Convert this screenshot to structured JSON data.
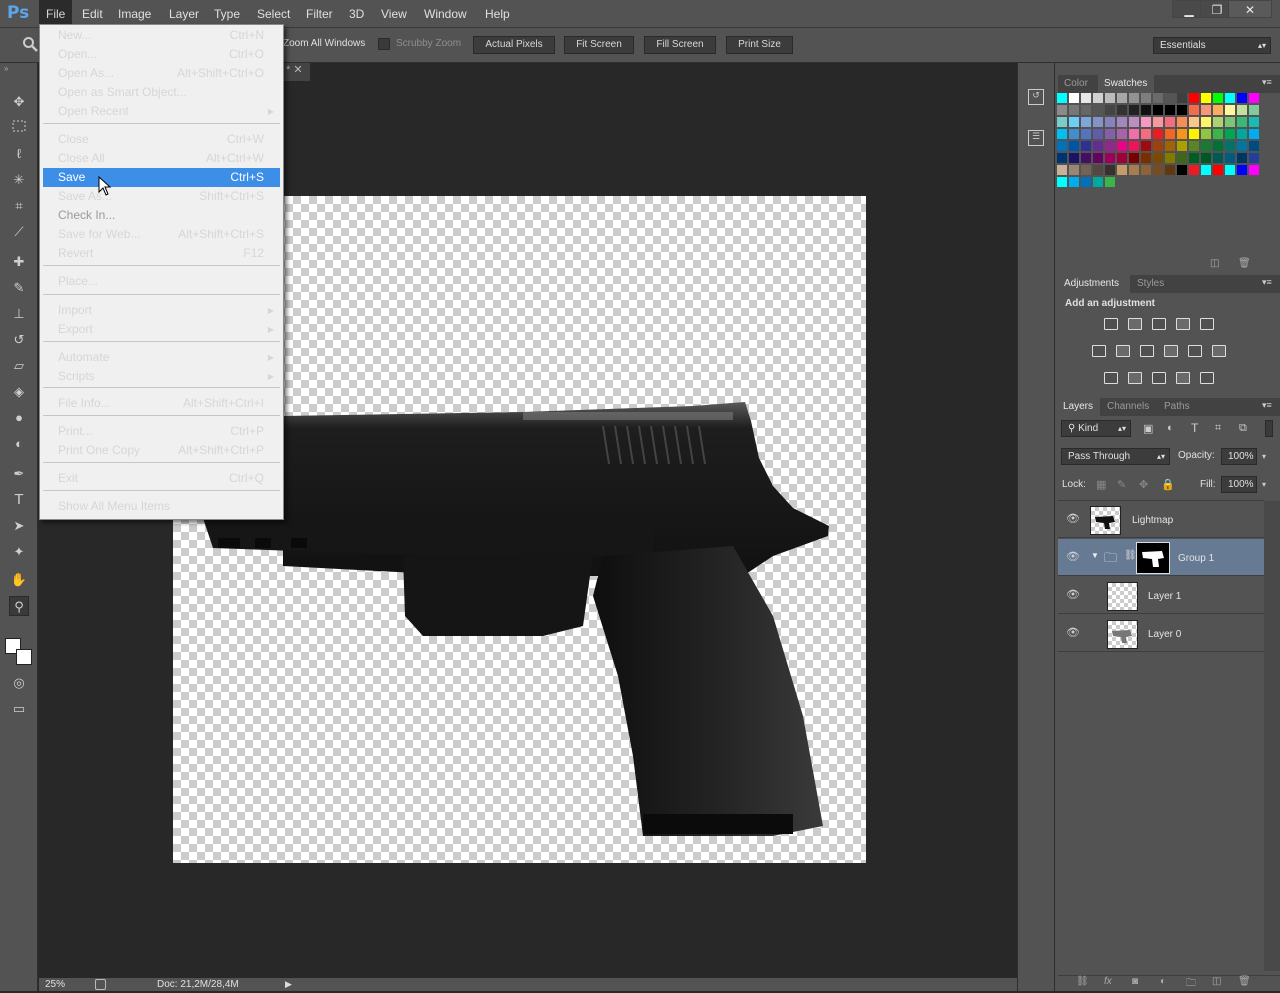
{
  "app": {
    "logo": "Ps"
  },
  "menubar": {
    "items": [
      "File",
      "Edit",
      "Image",
      "Layer",
      "Type",
      "Select",
      "Filter",
      "3D",
      "View",
      "Window",
      "Help"
    ],
    "window_controls": [
      "▁",
      "❐",
      "✕"
    ]
  },
  "options_bar": {
    "zoom_all_windows": "Zoom All Windows",
    "scrubby_zoom": "Scrubby Zoom",
    "buttons": [
      "Actual Pixels",
      "Fit Screen",
      "Fill Screen",
      "Print Size"
    ],
    "workspace": "Essentials"
  },
  "file_menu": {
    "items": [
      {
        "label": "New...",
        "shortcut": "Ctrl+N"
      },
      {
        "label": "Open...",
        "shortcut": "Ctrl+O"
      },
      {
        "label": "Open As...",
        "shortcut": "Alt+Shift+Ctrl+O"
      },
      {
        "label": "Open as Smart Object...",
        "shortcut": ""
      },
      {
        "label": "Open Recent",
        "shortcut": "",
        "submenu": true
      },
      {
        "label": "Close",
        "shortcut": "Ctrl+W"
      },
      {
        "label": "Close All",
        "shortcut": "Alt+Ctrl+W"
      },
      {
        "label": "Save",
        "shortcut": "Ctrl+S",
        "highlighted": true
      },
      {
        "label": "Save As...",
        "shortcut": "Shift+Ctrl+S"
      },
      {
        "label": "Check In...",
        "shortcut": "",
        "disabled": true
      },
      {
        "label": "Save for Web...",
        "shortcut": "Alt+Shift+Ctrl+S"
      },
      {
        "label": "Revert",
        "shortcut": "F12"
      },
      {
        "label": "Place...",
        "shortcut": ""
      },
      {
        "label": "Import",
        "shortcut": "",
        "submenu": true
      },
      {
        "label": "Export",
        "shortcut": "",
        "submenu": true
      },
      {
        "label": "Automate",
        "shortcut": "",
        "submenu": true
      },
      {
        "label": "Scripts",
        "shortcut": "",
        "submenu": true
      },
      {
        "label": "File Info...",
        "shortcut": "Alt+Shift+Ctrl+I"
      },
      {
        "label": "Print...",
        "shortcut": "Ctrl+P"
      },
      {
        "label": "Print One Copy",
        "shortcut": "Alt+Shift+Ctrl+P"
      },
      {
        "label": "Exit",
        "shortcut": "Ctrl+Q"
      },
      {
        "label": "Show All Menu Items",
        "shortcut": ""
      }
    ]
  },
  "status": {
    "zoom": "25%",
    "doc": "Doc: 21,2M/28,4M"
  },
  "color_panel": {
    "tabs": [
      "Color",
      "Swatches"
    ]
  },
  "adjustments_panel": {
    "tabs": [
      "Adjustments",
      "Styles"
    ],
    "heading": "Add an adjustment"
  },
  "layers_panel": {
    "tabs": [
      "Layers",
      "Channels",
      "Paths"
    ],
    "filter_kind": "Kind",
    "blend_mode": "Pass Through",
    "opacity_label": "Opacity:",
    "opacity": "100%",
    "lock_label": "Lock:",
    "fill_label": "Fill:",
    "fill": "100%",
    "layers": [
      {
        "name": "Lightmap"
      },
      {
        "name": "Group 1",
        "selected": true
      },
      {
        "name": "Layer 1"
      },
      {
        "name": "Layer 0"
      }
    ]
  },
  "colors": {
    "menu_highlight": "#3d8ee6",
    "selected_layer": "#667a93",
    "ps_blue": "#5aa6e8"
  }
}
